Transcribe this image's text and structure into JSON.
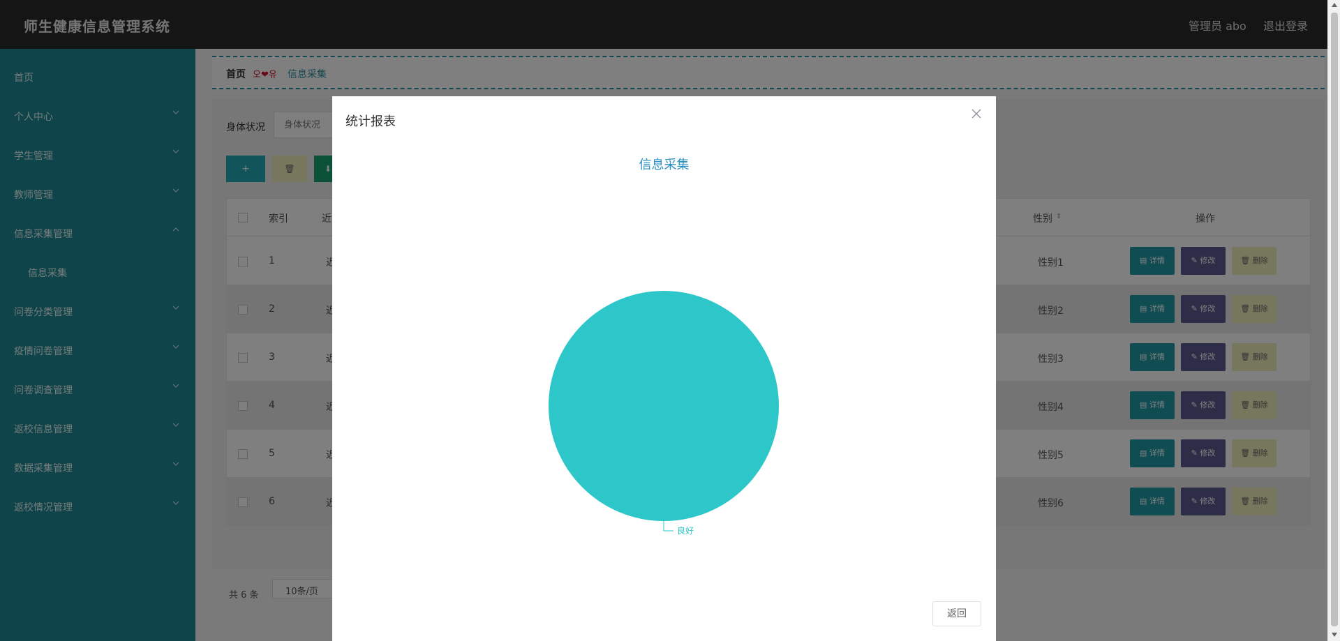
{
  "header": {
    "title": "师生健康信息管理系统",
    "user": "管理员 abo",
    "logout": "退出登录"
  },
  "sidebar": {
    "items": [
      {
        "label": "首页",
        "chevron": "none"
      },
      {
        "label": "个人中心",
        "chevron": "down"
      },
      {
        "label": "学生管理",
        "chevron": "down"
      },
      {
        "label": "教师管理",
        "chevron": "down"
      },
      {
        "label": "信息采集管理",
        "chevron": "up"
      },
      {
        "label": "信息采集",
        "chevron": "none",
        "sub": true
      },
      {
        "label": "问卷分类管理",
        "chevron": "down"
      },
      {
        "label": "疫情问卷管理",
        "chevron": "down"
      },
      {
        "label": "问卷调查管理",
        "chevron": "down"
      },
      {
        "label": "返校信息管理",
        "chevron": "down"
      },
      {
        "label": "数据采集管理",
        "chevron": "down"
      },
      {
        "label": "返校情况管理",
        "chevron": "down"
      }
    ]
  },
  "breadcrumb": {
    "home": "首页",
    "separator": "오❤유",
    "current": "信息采集"
  },
  "filter": {
    "label": "身体状况",
    "placeholder": "身体状况"
  },
  "toolbar": {
    "add": "+",
    "delete": "🗑",
    "export": "⬇"
  },
  "table": {
    "headers": {
      "index": "索引",
      "truncated": "近",
      "gender": "性别",
      "actions": "操作"
    },
    "rows": [
      {
        "index": "1",
        "truncated": "近",
        "gender": "性别1"
      },
      {
        "index": "2",
        "truncated": "近",
        "gender": "性别2"
      },
      {
        "index": "3",
        "truncated": "近",
        "gender": "性别3"
      },
      {
        "index": "4",
        "truncated": "近",
        "gender": "性别4"
      },
      {
        "index": "5",
        "truncated": "近",
        "gender": "性别5"
      },
      {
        "index": "6",
        "truncated": "近",
        "gender": "性别6"
      }
    ],
    "row_actions": {
      "detail": "▤ 详情",
      "edit": "✎ 修改",
      "remove": "🗑 删除"
    }
  },
  "pager": {
    "total": "共 6 条",
    "page_size": "10条/页"
  },
  "modal": {
    "title": "统计报表",
    "back": "返回"
  },
  "chart_data": {
    "type": "pie",
    "title": "信息采集",
    "categories": [
      "良好"
    ],
    "values": [
      1
    ],
    "colors": [
      "#2ec7c9"
    ]
  },
  "colors": {
    "header_bg": "#2b2b2b",
    "sidebar_bg": "#1f8b94",
    "accent": "#22a8b3",
    "pie": "#2ec7c9",
    "chart_title": "#2a8fc2"
  }
}
